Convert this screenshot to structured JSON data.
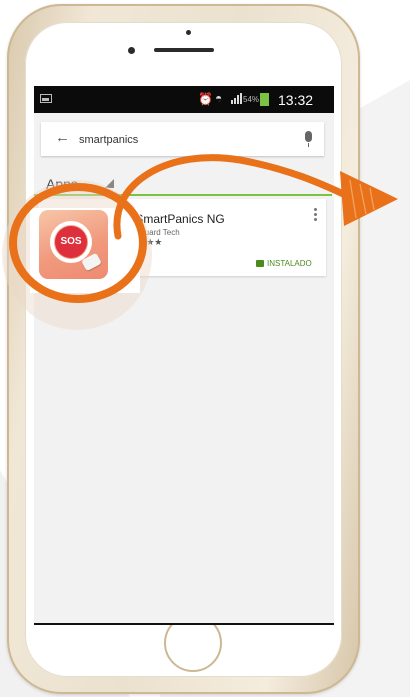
{
  "status_bar": {
    "battery_percent": "54%",
    "time": "13:32"
  },
  "search": {
    "query": "smartpanics"
  },
  "section": {
    "label": "Apps"
  },
  "app_result": {
    "title": "1. SmartPanics NG",
    "developer": "Soft Guard Tech",
    "rating_stars": "★★★★★",
    "rating_value": 4.5,
    "installed_label": "INSTALADO",
    "icon_text": "SOS"
  },
  "colors": {
    "accent_orange": "#e8711a",
    "play_green": "#7cc243",
    "sos_red": "#dd2f3c",
    "phone_gold": "#ebe1cf"
  },
  "icons": {
    "back": "arrow-left-icon",
    "mic": "microphone-icon",
    "overflow": "vertical-dots-icon",
    "installed": "shopping-bag-icon"
  }
}
